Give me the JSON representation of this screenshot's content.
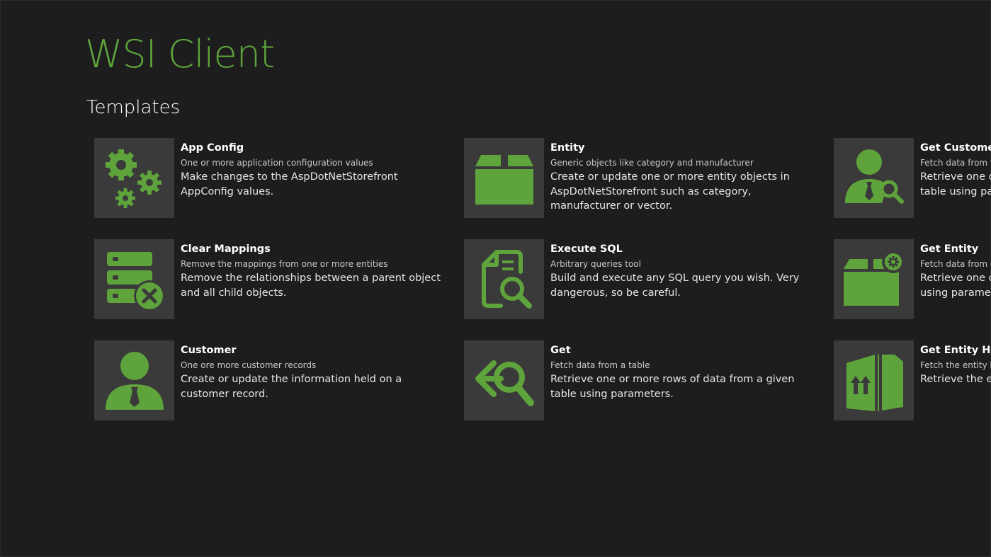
{
  "app": {
    "title": "WSI Client",
    "accent_color": "#5ea33b"
  },
  "section": {
    "title": "Templates"
  },
  "templates": [
    {
      "icon": "gears-icon",
      "name": "App Config",
      "subtitle": "One or more application configuration values",
      "description": "Make changes to the AspDotNetStorefront AppConfig values."
    },
    {
      "icon": "database-remove-icon",
      "name": "Clear Mappings",
      "subtitle": "Remove the mappings from one or more entities",
      "description": "Remove the relationships between a parent object and all child objects."
    },
    {
      "icon": "person-icon",
      "name": "Customer",
      "subtitle": "One ore more customer records",
      "description": "Create or update the information held on a customer record."
    },
    {
      "icon": "box-icon",
      "name": "Entity",
      "subtitle": "Generic objects like category and manufacturer",
      "description": "Create or update one or more entity objects in AspDotNetStorefront such as category, manufacturer or vector."
    },
    {
      "icon": "document-search-icon",
      "name": "Execute SQL",
      "subtitle": "Arbitrary queries tool",
      "description": "Build and execute any SQL query you wish. Very dangerous, so be careful."
    },
    {
      "icon": "arrow-search-icon",
      "name": "Get",
      "subtitle": "Fetch data from a table",
      "description": "Retrieve one or more rows of data from a given table using parameters."
    },
    {
      "icon": "person-search-icon",
      "name": "Get Customer",
      "subtitle": "Fetch data from th",
      "description": "Retrieve one or",
      "description_line2": "table using para"
    },
    {
      "icon": "box-gear-icon",
      "name": "Get Entity",
      "subtitle": "Fetch data from or",
      "description": "Retrieve one or",
      "description_line2": "using paramete"
    },
    {
      "icon": "open-box-icon",
      "name": "Get Entity Help",
      "subtitle": "Fetch the entity he",
      "description": "Retrieve the ent"
    }
  ]
}
